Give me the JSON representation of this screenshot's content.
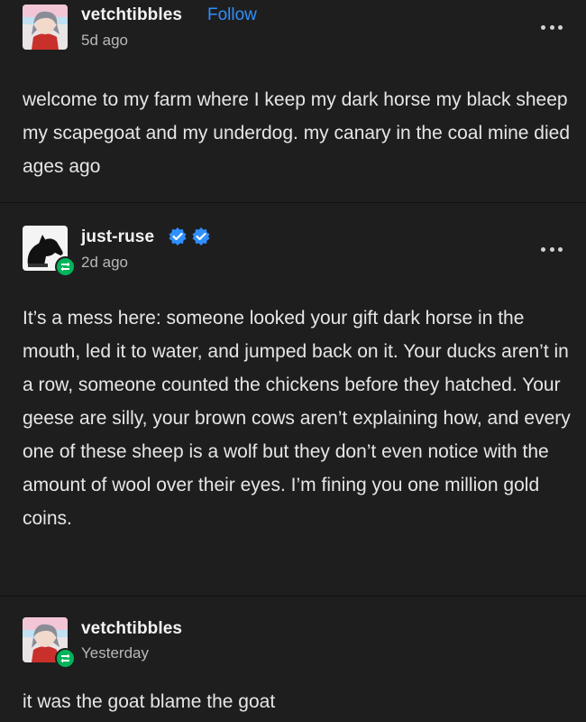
{
  "posts": [
    {
      "username": "vetchtibbles",
      "follow_label": "Follow",
      "timestamp": "5d ago",
      "body": "welcome to my farm where I keep my dark horse my black sheep my scapegoat and my underdog. my canary in the coal mine died ages ago",
      "avatar_icon": "anime-character-avatar",
      "menu_icon": "more-options-icon"
    },
    {
      "username": "just-ruse",
      "timestamp": "2d ago",
      "body": "It’s a mess here: someone looked your gift dark horse in the mouth, led it to water, and jumped back on it. Your ducks aren’t in a row, someone counted the chickens before they hatched. Your geese are silly, your brown cows aren’t explaining how, and every one of these sheep is a wolf but they don’t even notice with the amount of wool over their eyes. I’m fining you one million gold coins.",
      "avatar_icon": "black-horse-avatar",
      "badges": [
        "verified-badge-icon",
        "verified-badge-icon"
      ],
      "reblog_icon": "reblog-icon",
      "menu_icon": "more-options-icon"
    },
    {
      "username": "vetchtibbles",
      "timestamp": "Yesterday",
      "body": "it was the goat blame the goat",
      "avatar_icon": "anime-character-avatar",
      "reblog_icon": "reblog-icon"
    }
  ],
  "colors": {
    "background": "#1e1e1e",
    "follow_link": "#2f8fff",
    "verified_badge": "#2f8fff",
    "reblog_badge": "#00b45a"
  }
}
